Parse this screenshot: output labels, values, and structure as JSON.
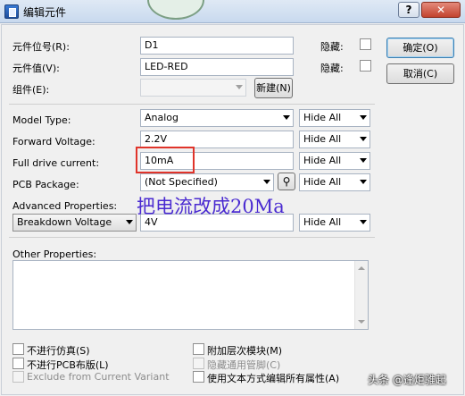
{
  "window": {
    "title": "编辑元件",
    "help_label": "?",
    "close_label": "✕"
  },
  "fields": {
    "ref_label": "元件位号(R):",
    "ref_value": "D1",
    "hidden_label": "隐藏:",
    "value_label": "元件值(V):",
    "value_value": "LED-RED",
    "group_label": "组件(E):",
    "new_button": "新建(N)"
  },
  "buttons": {
    "ok": "确定(O)",
    "cancel": "取消(C)"
  },
  "properties": {
    "model_type_label": "Model Type:",
    "model_type_value": "Analog",
    "forward_voltage_label": "Forward Voltage:",
    "forward_voltage_value": "2.2V",
    "full_drive_label": "Full drive current:",
    "full_drive_value": "10mA",
    "pcb_package_label": "PCB Package:",
    "pcb_package_value": "(Not Specified)",
    "advanced_label": "Advanced Properties:",
    "advanced_select": "Breakdown Voltage",
    "advanced_value": "4V",
    "hide_all": "Hide All",
    "other_label": "Other Properties:"
  },
  "options": {
    "no_sim": "不进行仿真(S)",
    "no_pcb": "不进行PCB布版(L)",
    "exclude_variant": "Exclude from Current Variant",
    "attach_hierarchy": "附加层次模块(M)",
    "hide_common_pins": "隐藏通用管脚(C)",
    "text_edit_all": "使用文本方式编辑所有属性(A)"
  },
  "annotation": "把电流改成20Ma",
  "watermark": "头条 @逢炬骓起"
}
